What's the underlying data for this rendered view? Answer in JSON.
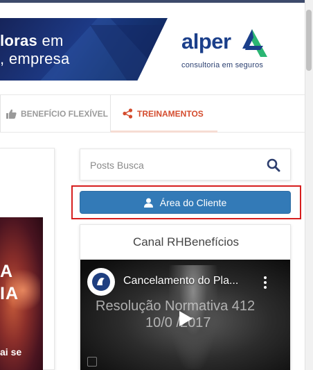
{
  "banner": {
    "line1_bold": "loras",
    "line1_rest": " em",
    "line2": ", empresa"
  },
  "logo": {
    "name": "alper",
    "tagline": "consultoria em seguros",
    "brand_color": "#1b3f8a",
    "mark_color": "#2bb673"
  },
  "nav": {
    "items": [
      {
        "label": "BENEFÍCIO FLEXÍVEL",
        "icon": "thumbs-up-icon",
        "active": false
      },
      {
        "label": "TREINAMENTOS",
        "icon": "share-icon",
        "active": true
      }
    ],
    "active_color": "#d44c2e"
  },
  "left_card": {
    "line1": "A",
    "line2": "IA",
    "line3": "ai se"
  },
  "sidebar": {
    "search": {
      "placeholder": "Posts Busca",
      "value": ""
    },
    "client_button": {
      "label": "Área do Cliente",
      "color": "#337ab7"
    },
    "channel": {
      "title": "Canal RHBenefícios",
      "video_title": "Cancelamento do Pla...",
      "overlay_line1": "Resolução Normativa 412",
      "overlay_line2": "10/0 /2017"
    }
  },
  "highlight_color": "#d61e1e"
}
